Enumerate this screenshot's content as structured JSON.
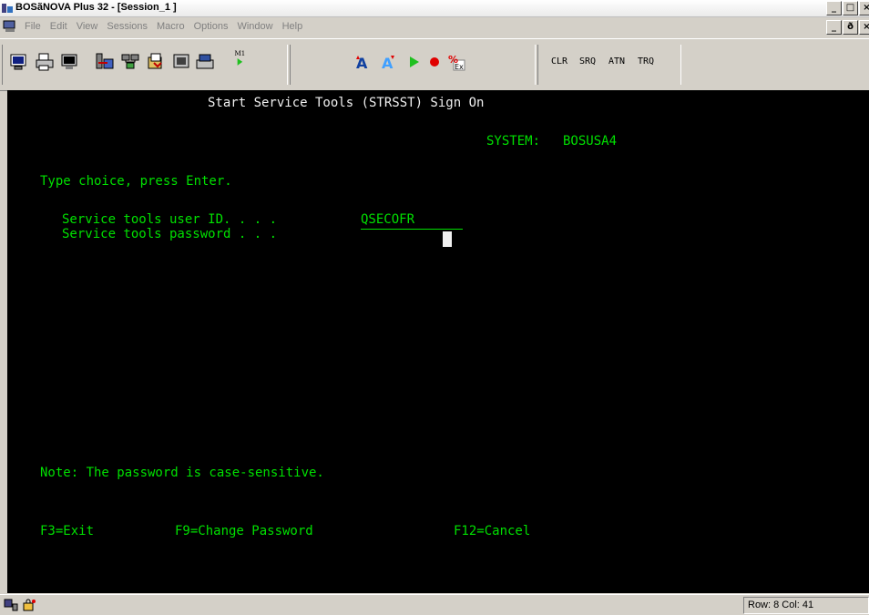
{
  "window": {
    "title": "BOSãNOVA Plus 32 - [Session_1 ]",
    "minimize": "_",
    "maximize": "□",
    "close": "×",
    "restore": "ð"
  },
  "menu": {
    "items": [
      "File",
      "Edit",
      "View",
      "Sessions",
      "Macro",
      "Options",
      "Window",
      "Help"
    ]
  },
  "toolbar": {
    "macro_label": "M1",
    "keywords": [
      "CLR",
      "SRQ",
      "ATN",
      "TRQ"
    ]
  },
  "terminal": {
    "screen_title": "Start Service Tools (STRSST) Sign On",
    "system_label": "SYSTEM:",
    "system_name": "BOSUSA4",
    "instruction": "Type choice, press Enter.",
    "user_id_label": "Service tools user ID. . . .",
    "user_id_value": "QSECOFR",
    "password_label": "Service tools password . . .",
    "note": "Note: The password is case-sensitive.",
    "fkeys": [
      "F3=Exit",
      "F9=Change Password",
      "F12=Cancel"
    ]
  },
  "status": {
    "row_col": "Row: 8  Col: 41"
  }
}
